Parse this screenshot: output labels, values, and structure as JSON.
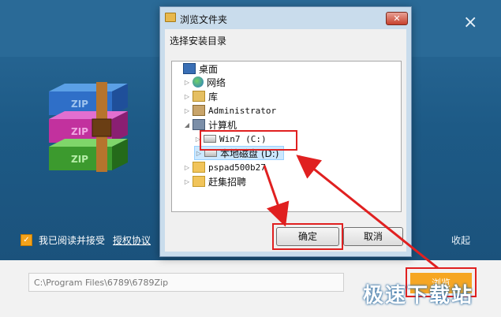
{
  "installer": {
    "agree_label": "我已阅读并接受",
    "agree_checked": true,
    "license_link": "授权协议",
    "collapse_label": "收起",
    "install_path": "C:\\Program Files\\6789\\6789Zip",
    "browse_label": "浏览",
    "close_glyph": "×"
  },
  "dialog": {
    "title": "浏览文件夹",
    "close_glyph": "✕",
    "prompt": "选择安装目录",
    "tree": [
      {
        "label": "桌面",
        "icon": "desktop-icon",
        "expander": ""
      },
      {
        "label": "网络",
        "icon": "network-icon",
        "expander": "▷"
      },
      {
        "label": "库",
        "icon": "library-icon",
        "expander": "▷"
      },
      {
        "label": "Administrator",
        "icon": "user-folder-icon",
        "expander": "▷"
      },
      {
        "label": "计算机",
        "icon": "computer-icon",
        "expander": "◢"
      },
      {
        "label": "Win7 (C:)",
        "icon": "drive-icon",
        "expander": "▷"
      },
      {
        "label": "本地磁盘 (D:)",
        "icon": "drive-icon",
        "expander": "▷",
        "selected": true
      },
      {
        "label": "pspad500b27",
        "icon": "folder-icon",
        "expander": "▷"
      },
      {
        "label": "赶集招聘",
        "icon": "folder-icon",
        "expander": "▷"
      }
    ],
    "ok_label": "确定",
    "cancel_label": "取消"
  },
  "watermark": "极速下载站",
  "colors": {
    "accent": "#f6a623",
    "highlight": "#e02020",
    "selection": "#cce8ff"
  }
}
